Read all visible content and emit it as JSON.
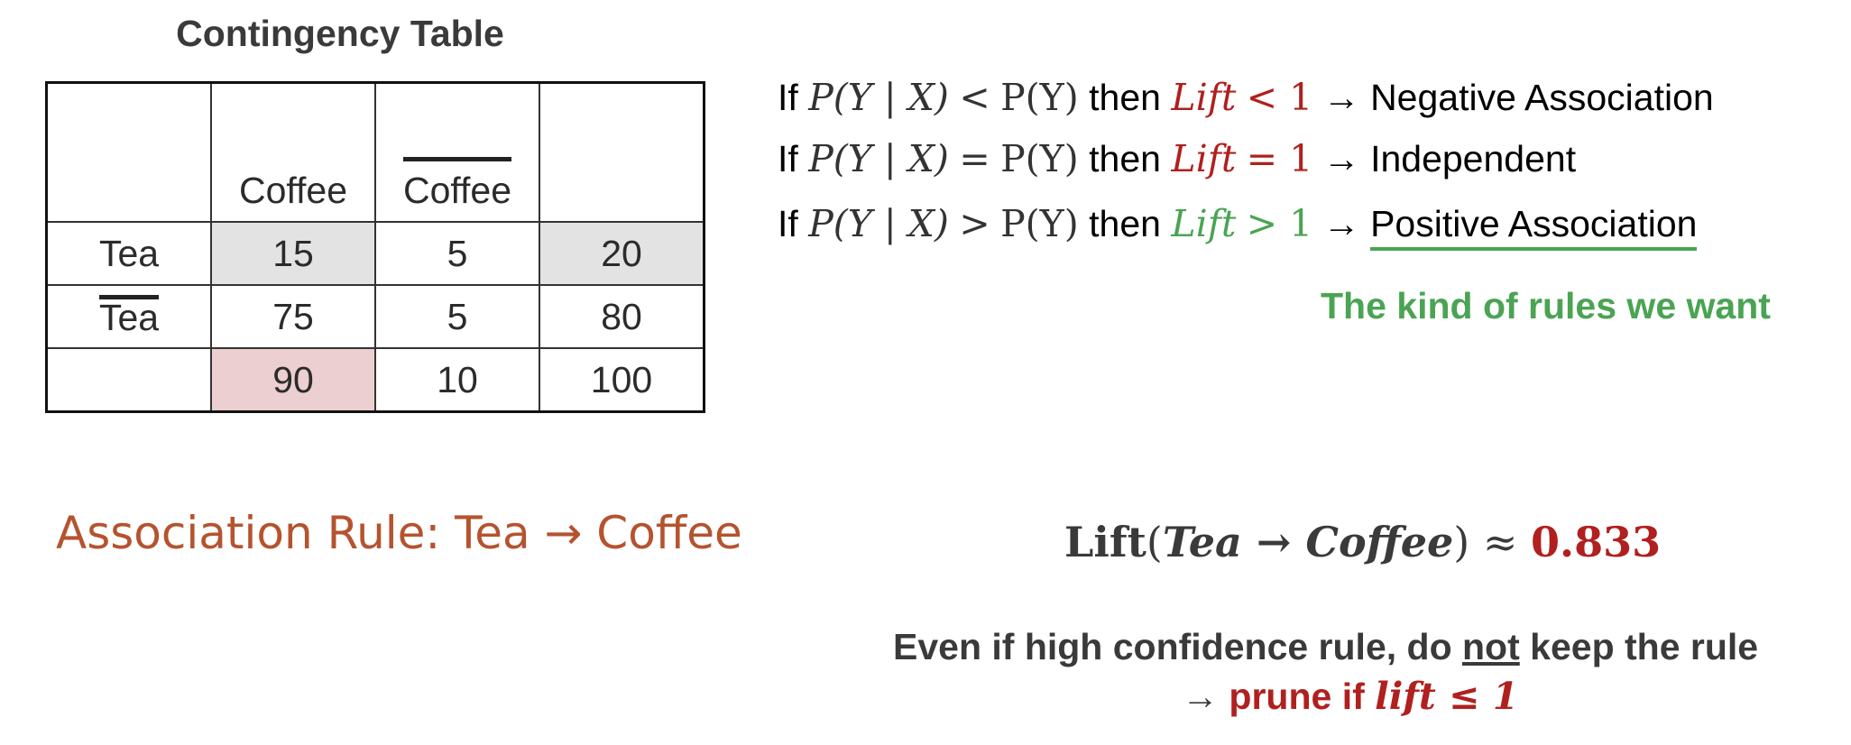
{
  "title": "Contingency Table",
  "table": {
    "header": [
      "",
      "Coffee",
      "Coffee",
      ""
    ],
    "header_overline": [
      false,
      false,
      true,
      false
    ],
    "rows": [
      {
        "label": "Tea",
        "label_overline": false,
        "cells": [
          "15",
          "5",
          "20"
        ]
      },
      {
        "label": "Tea",
        "label_overline": true,
        "cells": [
          "75",
          "5",
          "80"
        ]
      },
      {
        "label": "",
        "label_overline": false,
        "cells": [
          "90",
          "10",
          "100"
        ]
      }
    ],
    "highlight_colors": {
      "gray": "#e3e3e3",
      "pink": "#eccfd0"
    }
  },
  "association_rule": "Association Rule: Tea → Coffee",
  "statements": [
    {
      "prefix": "If",
      "lhs": "P(Y | X)",
      "op": "<",
      "rhs": "P(Y)",
      "then": "then",
      "lift_word": "Lift",
      "lift_op": "< 1",
      "arrow": "→",
      "result": "Negative Association",
      "color": "#b0201e"
    },
    {
      "prefix": "If",
      "lhs": "P(Y | X)",
      "op": "=",
      "rhs": "P(Y)",
      "then": "then",
      "lift_word": "Lift",
      "lift_op": "= 1",
      "arrow": "→",
      "result": "Independent",
      "color": "#b0201e"
    },
    {
      "prefix": "If",
      "lhs": "P(Y | X)",
      "op": ">",
      "rhs": "P(Y)",
      "then": "then",
      "lift_word": "Lift",
      "lift_op": "> 1",
      "arrow": "→",
      "result": "Positive Association",
      "color": "#4aa453"
    }
  ],
  "kind_of_rules": "The kind of rules we want",
  "lift_equation": {
    "name": "Lift",
    "open": "(",
    "arg": "Tea → Coffee",
    "close": ")",
    "approx": "≈",
    "value": "0.833"
  },
  "note": {
    "line1_a": "Even if high confidence rule, do ",
    "line1_u": "not",
    "line1_b": " keep the rule",
    "line2_arrow": "→",
    "line2_text": "prune if ",
    "line2_math": "lift ≤ 1"
  },
  "colors": {
    "red": "#b0201e",
    "green": "#4aa453",
    "rule_orange": "#b5532f"
  }
}
